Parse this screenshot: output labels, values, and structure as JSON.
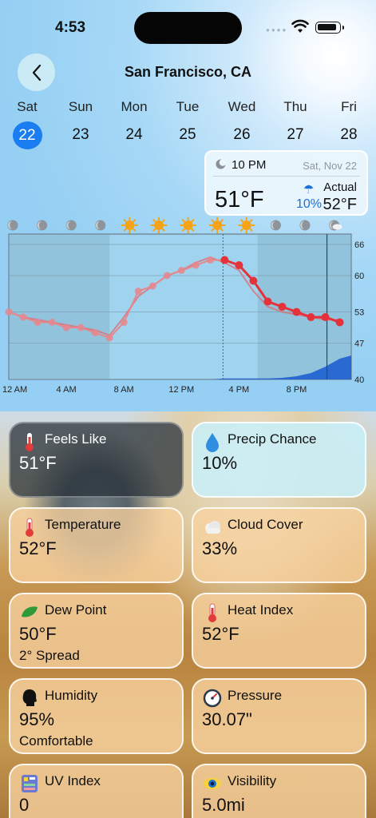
{
  "status_bar": {
    "time": "4:53"
  },
  "header": {
    "city": "San Francisco, CA"
  },
  "days": [
    {
      "dow": "Sat",
      "num": "22",
      "selected": true
    },
    {
      "dow": "Sun",
      "num": "23"
    },
    {
      "dow": "Mon",
      "num": "24"
    },
    {
      "dow": "Tue",
      "num": "25"
    },
    {
      "dow": "Wed",
      "num": "26"
    },
    {
      "dow": "Thu",
      "num": "27"
    },
    {
      "dow": "Fri",
      "num": "28"
    }
  ],
  "tooltip": {
    "time": "10 PM",
    "date": "Sat, Nov 22",
    "temp": "51°F",
    "precip": "10%",
    "actual_label": "Actual",
    "actual": "52°F"
  },
  "chart_data": {
    "type": "line",
    "x_tick_labels": [
      "12 AM",
      "4 AM",
      "8 AM",
      "12 PM",
      "4 PM",
      "8 PM"
    ],
    "y_tick_labels": [
      "66",
      "60",
      "53",
      "47",
      "40"
    ],
    "ylim": [
      40,
      68
    ],
    "hours": [
      0,
      1,
      2,
      3,
      4,
      5,
      6,
      7,
      8,
      9,
      10,
      11,
      12,
      13,
      14,
      15,
      16,
      17,
      18,
      19,
      20,
      21,
      22,
      23
    ],
    "series": [
      {
        "values": [
          53,
          52,
          51,
          51,
          50,
          50,
          49,
          48,
          51,
          57,
          58,
          60,
          61,
          62,
          63,
          63,
          62,
          59,
          55,
          54,
          53,
          52,
          52,
          51
        ]
      },
      {
        "values": [
          53,
          52,
          51.5,
          51,
          50.5,
          50,
          49.5,
          48.5,
          52,
          56,
          58,
          60,
          61,
          62.5,
          63.5,
          62.5,
          61,
          57,
          54,
          53,
          52.5,
          52,
          51.5,
          51.5
        ]
      }
    ],
    "precip_area": [
      0,
      0,
      0,
      0,
      0,
      0,
      0,
      0,
      0,
      0,
      0,
      0,
      0,
      0,
      0,
      0.3,
      0.3,
      0.3,
      0.3,
      0.5,
      1,
      2,
      4,
      6.5
    ],
    "condition_icons": [
      "moon",
      "moon",
      "moon",
      "moon",
      "moon",
      "moon",
      "moon",
      "moon",
      "sun",
      "sun",
      "sun",
      "sun",
      "sun",
      "sun",
      "sun",
      "sun",
      "sun",
      "sun",
      "moon",
      "moon",
      "moon",
      "moon",
      "moon",
      "moon-cloud"
    ],
    "icon_row": [
      "moon",
      "moon",
      "moon",
      "moon",
      "sun",
      "sun",
      "sun",
      "sun",
      "sun",
      "moon",
      "moon",
      "moon-cloud"
    ],
    "now_hour": 15,
    "selected_hour": 22
  },
  "cards": [
    {
      "title": "Feels Like",
      "value": "51°F",
      "sub": "",
      "icon": "thermometer-icon",
      "style": "dark"
    },
    {
      "title": "Precip Chance",
      "value": "10%",
      "sub": "",
      "icon": "raindrop-icon",
      "style": "cyan"
    },
    {
      "title": "Temperature",
      "value": "52°F",
      "sub": "",
      "icon": "thermometer-icon",
      "style": "warm"
    },
    {
      "title": "Cloud Cover",
      "value": "33%",
      "sub": "",
      "icon": "cloud-icon",
      "style": "warm"
    },
    {
      "title": "Dew Point",
      "value": "50°F",
      "sub": "2° Spread",
      "icon": "leaf-icon",
      "style": "warm"
    },
    {
      "title": "Heat Index",
      "value": "52°F",
      "sub": "",
      "icon": "thermometer-icon",
      "style": "warm"
    },
    {
      "title": "Humidity",
      "value": "95%",
      "sub": "Comfortable",
      "icon": "head-icon",
      "style": "warm"
    },
    {
      "title": "Pressure",
      "value": "30.07\"",
      "sub": "",
      "icon": "gauge-icon",
      "style": "warm"
    },
    {
      "title": "UV Index",
      "value": "0",
      "sub": "",
      "icon": "uv-meter-icon",
      "style": "warm"
    },
    {
      "title": "Visibility",
      "value": "5.0mi",
      "sub": "",
      "icon": "eye-icon",
      "style": "warm"
    }
  ],
  "colors": {
    "accent": "#1a7df2",
    "forecast_line": "#e5323a",
    "precip_fill": "#1e5fd0"
  }
}
